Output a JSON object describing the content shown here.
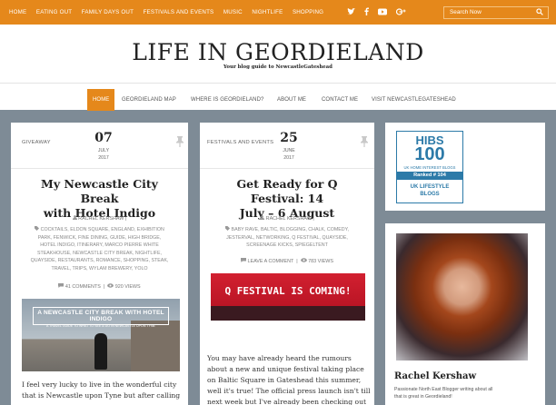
{
  "topbar": {
    "nav": [
      "HOME",
      "EATING OUT",
      "FAMILY DAYS OUT",
      "FESTIVALS AND EVENTS",
      "MUSIC",
      "NIGHTLIFE",
      "SHOPPING"
    ],
    "social_icons": [
      "twitter-icon",
      "facebook-icon",
      "youtube-icon",
      "google-plus-icon"
    ],
    "search_placeholder": "Search Now"
  },
  "header": {
    "title": "LIFE IN GEORDIELAND",
    "tagline": "Your blog guide to NewcastleGateshead"
  },
  "mainnav": [
    "HOME",
    "GEORDIELAND MAP",
    "WHERE IS GEORDIELAND?",
    "ABOUT ME",
    "CONTACT ME",
    "VISIT NEWCASTLEGATESHEAD"
  ],
  "posts": [
    {
      "category": "GIVEAWAY",
      "day": "07",
      "month": "JULY",
      "year": "2017",
      "title_lines": [
        "My Newcastle City Break",
        "with Hotel Indigo"
      ],
      "author": "RACHEL KERSHAW",
      "tag_lines": [
        "COCKTAILS, ELDON SQUARE, ENGLAND, EXHIBITION",
        "PARK, FENWICK, FINE DINING, GUIDE, HIGH BRIDGE,",
        "HOTEL INDIGO, ITINERARY, MARCO PIERRE WHITE",
        "STEAKHOUSE, NEWCASTLE CITY BREAK, NIGHTLIFE,",
        "QUAYSIDE, RESTAURANTS, ROMANCE, SHOPPING, STEAK,",
        "TRAVEL, TRIPS, WYLAM BREWERY, YOLO"
      ],
      "comments": "41 COMMENTS",
      "views": "920 VIEWS",
      "image_title": "A NEWCASTLE CITY BREAK WITH HOTEL INDIGO",
      "image_subtitle": "A TRAVEL GUIDE TO WHAT TO SEE & DO IN NEWCASTLE UPON TYNE",
      "excerpt_lines": [
        "I feel very lucky to live in the wonderful city",
        "that is Newcastle upon Tyne but after calling"
      ]
    },
    {
      "category": "FESTIVALS AND EVENTS",
      "day": "25",
      "month": "JUNE",
      "year": "2017",
      "title_lines": [
        "Get Ready for Q Festival: 14",
        "July – 6 August"
      ],
      "author": "RACHEL KERSHAW",
      "tag_lines": [
        "BABY RAVE, BALTIC, BLOGGING, CHALK, COMEDY,",
        "JESTERVAL, NETWORKING, Q FESTIVAL, QUAYSIDE,",
        "SCREENAGE KICKS, SPIEGELTENT"
      ],
      "comments": "LEAVE A COMMENT",
      "views": "783 VIEWS",
      "image_title": "Q FESTIVAL IS COMING!",
      "excerpt_lines": [
        "You may have already heard the rumours",
        "about a new and unique festival taking place",
        "on Baltic Square in Gateshead this summer,",
        "well it's true! The official press launch isn't till",
        "next week but I've already been checking out"
      ]
    }
  ],
  "sidebar": {
    "badge": {
      "line1": "HIBS",
      "line2": "100",
      "line3": "UK HOME INTEREST BLOGS",
      "rank": "Ranked # 104",
      "line5": "UK LIFESTYLE",
      "line6": "BLOGS"
    },
    "author_name": "Rachel Kershaw",
    "bio_lines": [
      "Passionate North East Blogger writing about all",
      "that is great in Geordieland!"
    ]
  }
}
